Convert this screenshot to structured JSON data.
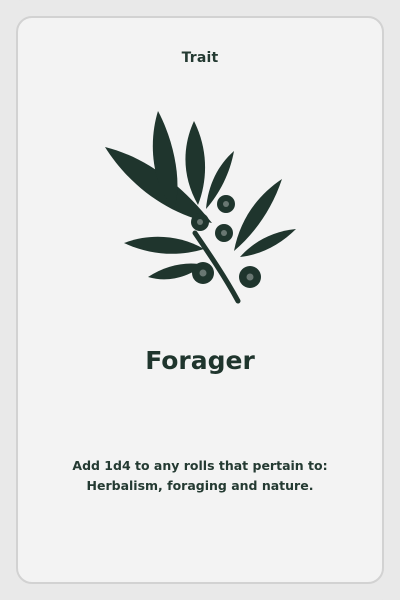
{
  "card": {
    "type_label": "Trait",
    "title": "Forager",
    "description": "Add 1d4 to any rolls that pertain to: Herbalism, foraging and nature.",
    "emblem_icon": "herb-branch-with-berries-icon"
  },
  "colors": {
    "ink": "#1f352d",
    "card_face": "#f3f3f3",
    "card_border": "#d2d2d2",
    "background": "#e9e9e9"
  }
}
